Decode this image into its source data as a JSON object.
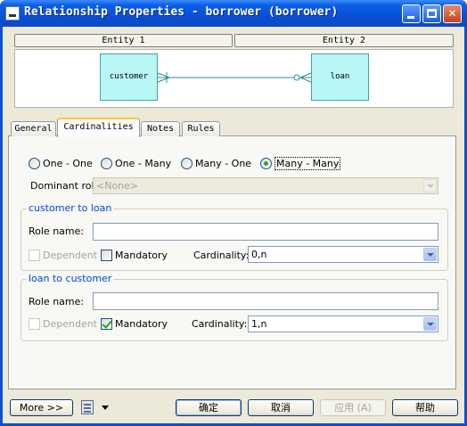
{
  "window": {
    "title": "Relationship Properties - borrower (borrower)"
  },
  "entities": {
    "entity1_header": "Entity 1",
    "entity2_header": "Entity 2",
    "entity1_name": "customer",
    "entity2_name": "loan"
  },
  "tabs": [
    {
      "label": "General"
    },
    {
      "label": "Cardinalities"
    },
    {
      "label": "Notes"
    },
    {
      "label": "Rules"
    }
  ],
  "cardinality_options": [
    {
      "label": "One - One",
      "selected": false
    },
    {
      "label": "One - Many",
      "selected": false
    },
    {
      "label": "Many - One",
      "selected": false
    },
    {
      "label": "Many - Many",
      "selected": true
    }
  ],
  "dominant_role": {
    "label": "Dominant role:",
    "value": "<None>"
  },
  "group1": {
    "title": "customer to loan",
    "role_name_label": "Role name:",
    "role_name_value": "",
    "dependent_label": "Dependent",
    "dependent_checked": false,
    "mandatory_label": "Mandatory",
    "mandatory_checked": false,
    "cardinality_label": "Cardinality:",
    "cardinality_value": "0,n"
  },
  "group2": {
    "title": "loan to customer",
    "role_name_label": "Role name:",
    "role_name_value": "",
    "dependent_label": "Dependent",
    "dependent_checked": false,
    "mandatory_label": "Mandatory",
    "mandatory_checked": true,
    "cardinality_label": "Cardinality:",
    "cardinality_value": "1,n"
  },
  "buttons": {
    "more": "More >>",
    "ok": "确定",
    "cancel": "取消",
    "apply": "应用 (A)",
    "help": "帮助"
  },
  "colors": {
    "titlebar": "#0a50d8",
    "entity_fill": "#b9f6f6",
    "group_title": "#0046d5"
  }
}
